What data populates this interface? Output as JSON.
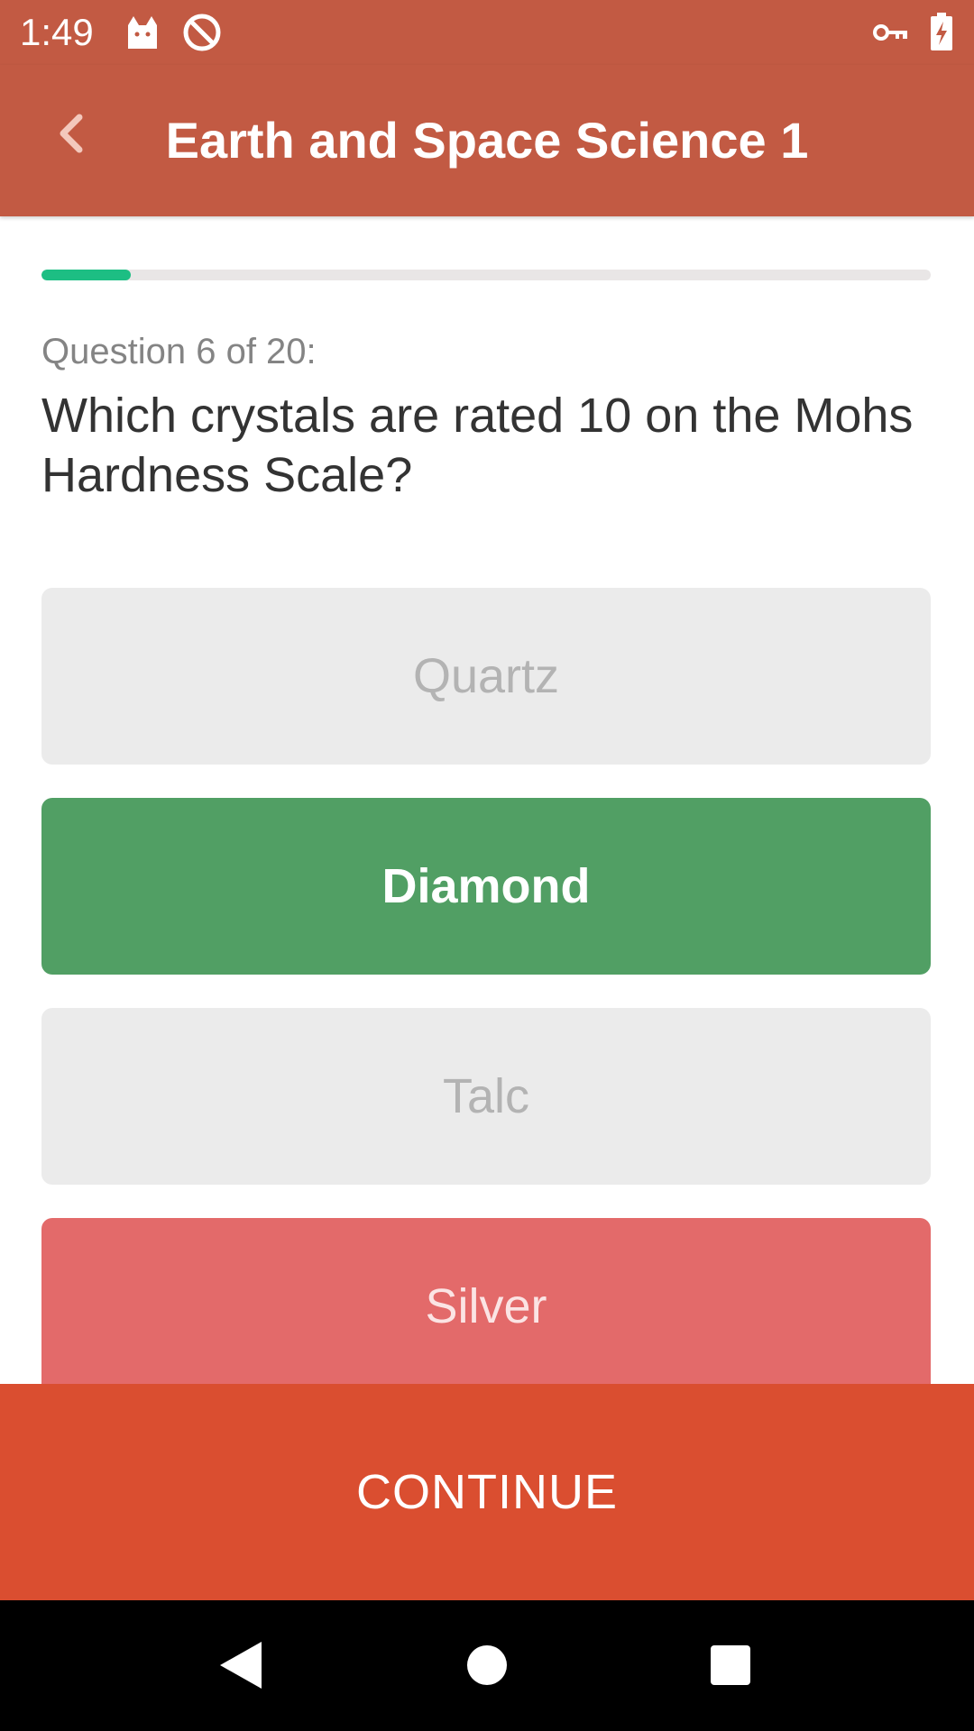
{
  "status_bar": {
    "time": "1:49",
    "icons": [
      "cat-icon",
      "do-not-disturb-icon",
      "vpn-key-icon",
      "battery-charging-icon"
    ]
  },
  "app_bar": {
    "title": "Earth and Space Science 1",
    "back_icon": "chevron-left-icon"
  },
  "progress": {
    "current": 6,
    "total": 20,
    "fraction": 0.1,
    "color": "#1dbe83"
  },
  "question": {
    "counter": "Question 6 of 20:",
    "text": "Which crystals are rated 10 on the Mohs Hardness Scale?"
  },
  "answers": [
    {
      "label": "Quartz",
      "state": "neutral"
    },
    {
      "label": "Diamond",
      "state": "correct"
    },
    {
      "label": "Talc",
      "state": "neutral"
    },
    {
      "label": "Silver",
      "state": "wrong"
    }
  ],
  "continue_button": {
    "label": "CONTINUE"
  },
  "navigation": {
    "icons": [
      "back-triangle-icon",
      "home-circle-icon",
      "recents-square-icon"
    ]
  },
  "colors": {
    "header": "#c25a43",
    "correct": "#519f64",
    "wrong": "#e36a6a",
    "continue": "#da4e30"
  }
}
